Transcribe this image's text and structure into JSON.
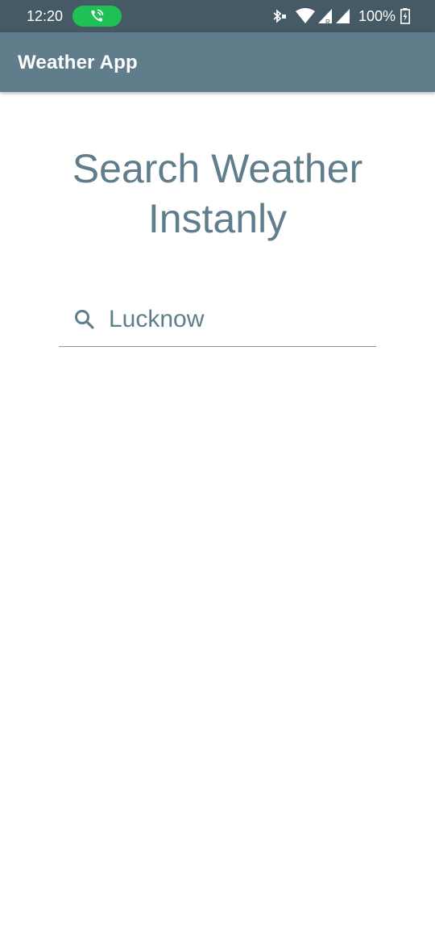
{
  "status_bar": {
    "time": "12:20",
    "battery_percent": "100%",
    "call_active": true,
    "icons": [
      "call-icon",
      "bluetooth-icon",
      "wifi-icon",
      "signal-icon",
      "signal-icon",
      "battery-charging-icon"
    ]
  },
  "app_bar": {
    "title": "Weather App",
    "color": "#607d8b"
  },
  "heading": {
    "line1": "Search Weather",
    "line2": "Instanly"
  },
  "search": {
    "value": "Lucknow",
    "icon": "search-icon"
  },
  "colors": {
    "status_bar": "#455a64",
    "primary": "#607d8b",
    "call_pill": "#1fc157"
  }
}
